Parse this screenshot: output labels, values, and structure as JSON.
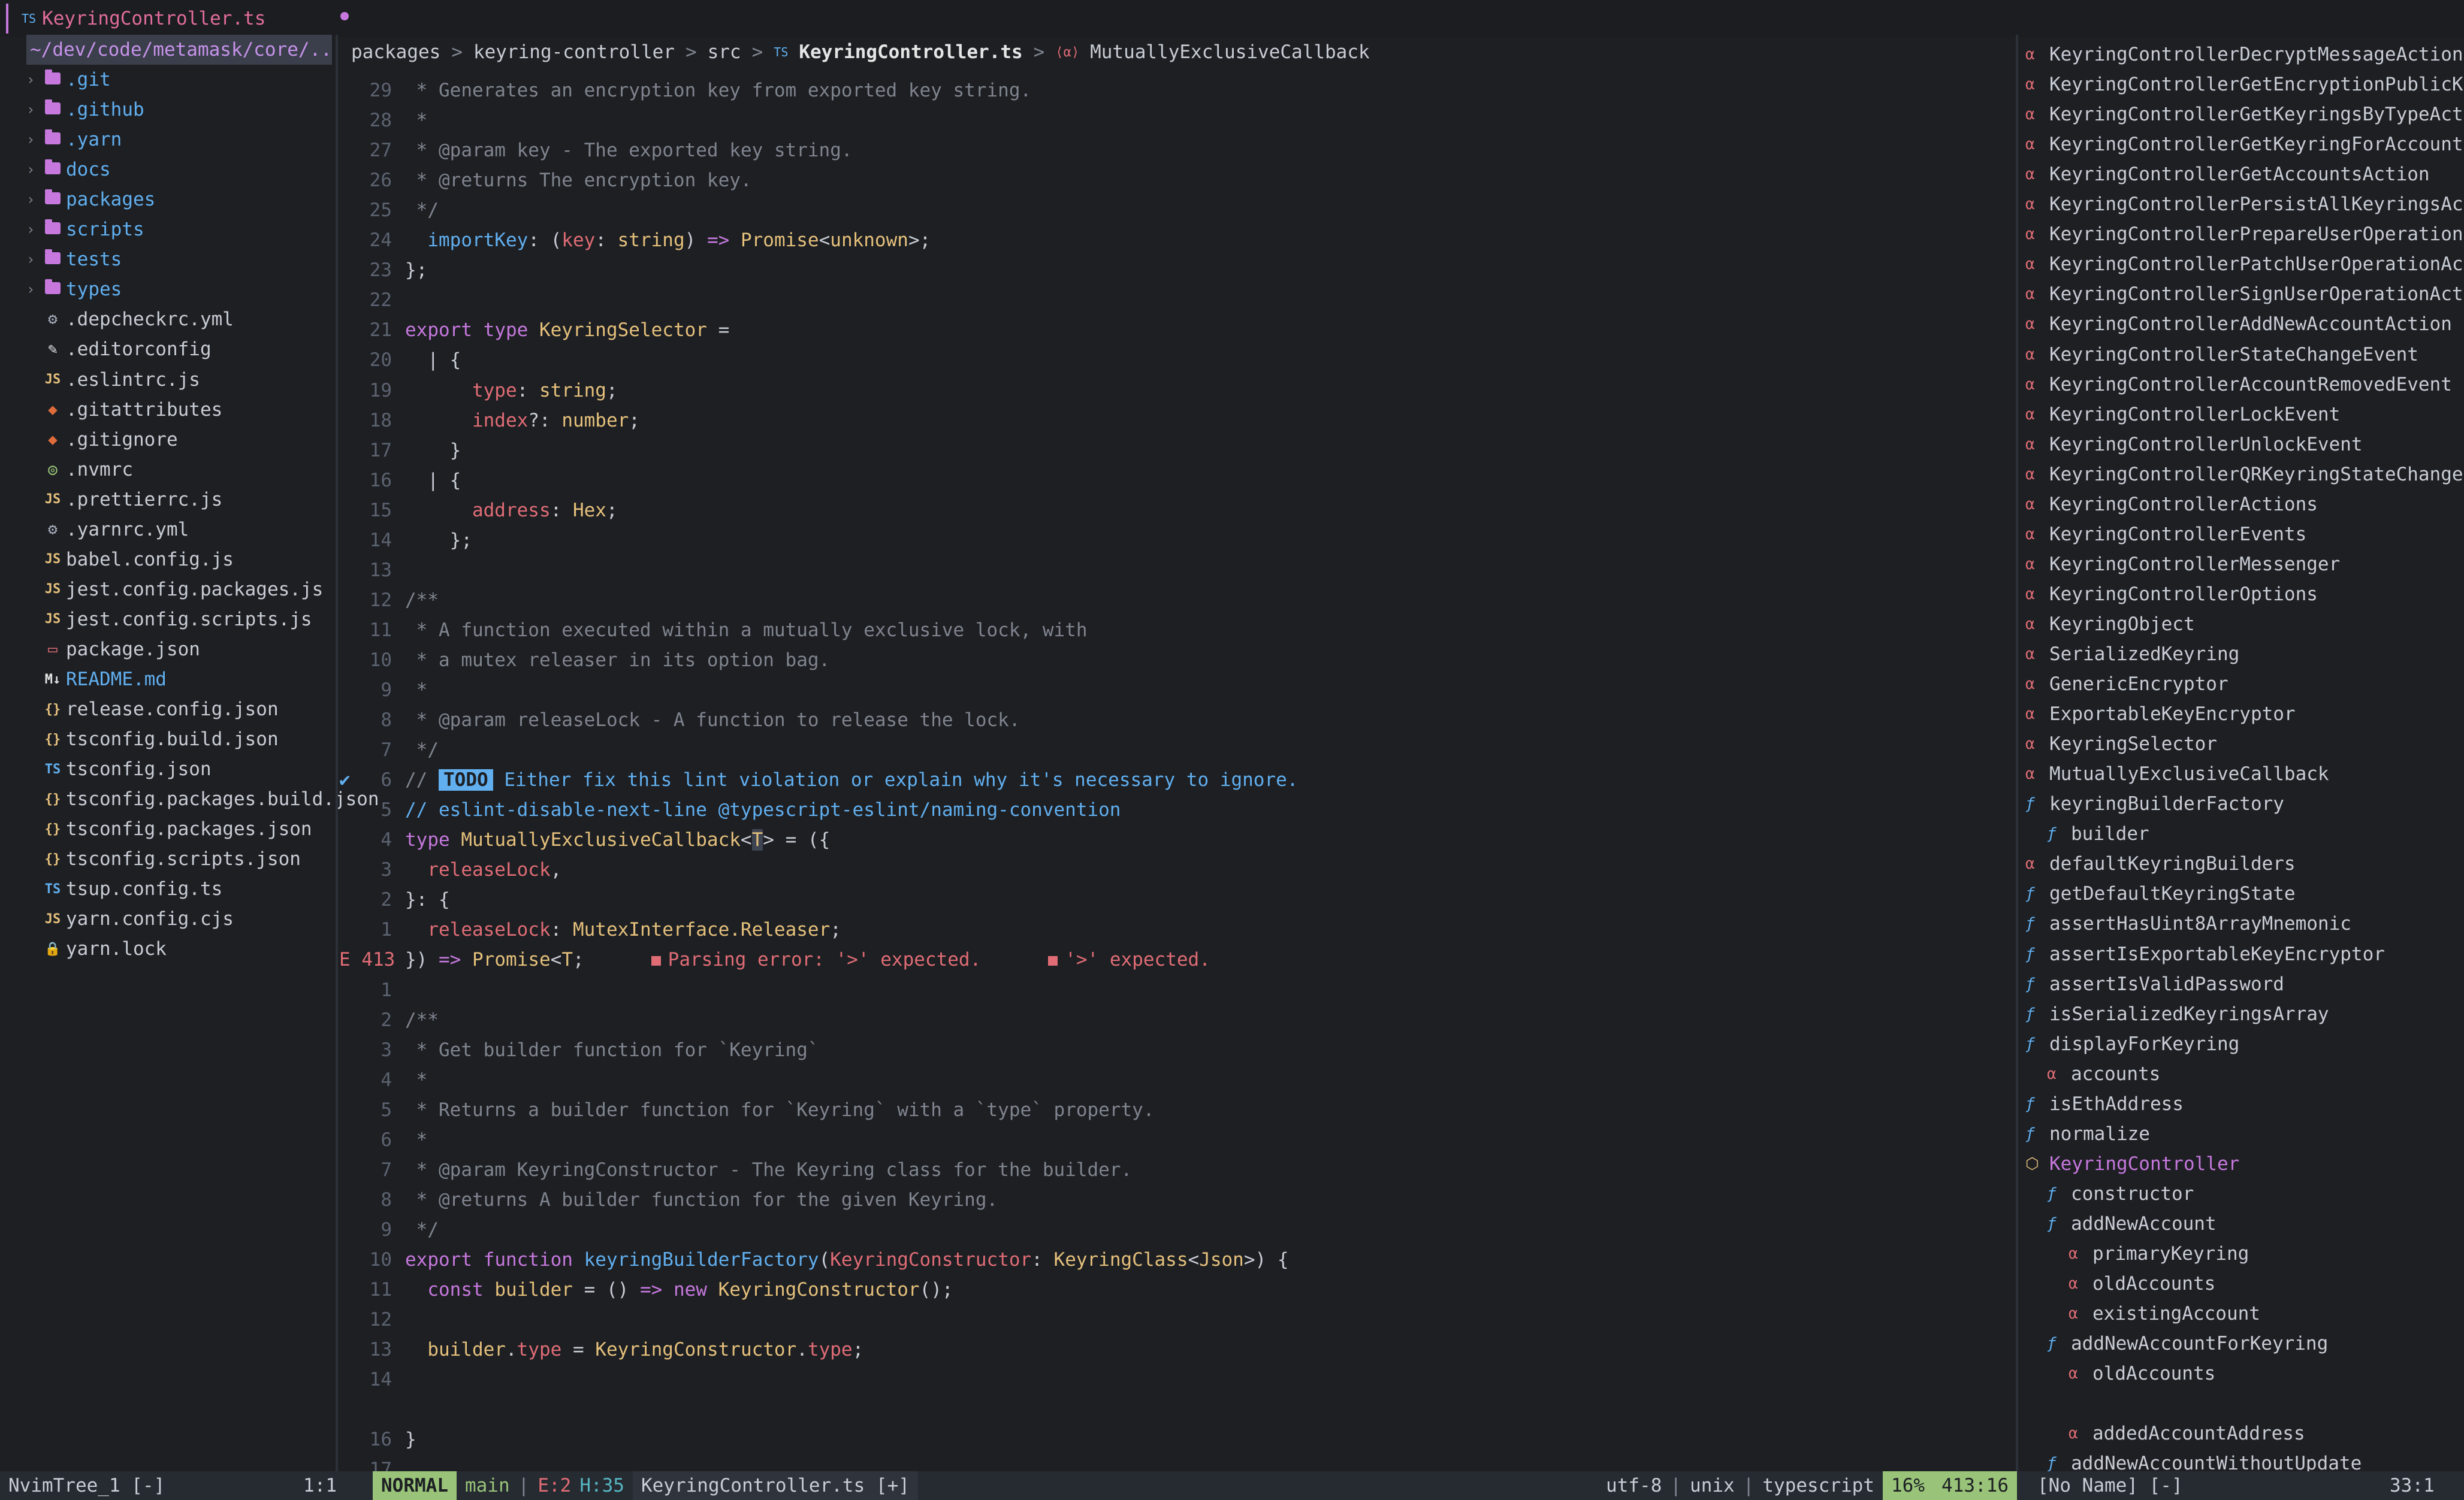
{
  "tabline": {
    "file_type": "TS",
    "file_name": "KeyringController.ts"
  },
  "tree": {
    "root": "~/dev/code/metamask/core/..",
    "dirs": [
      ".git",
      ".github",
      ".yarn",
      "docs",
      "packages",
      "scripts",
      "tests",
      "types"
    ],
    "files": [
      {
        "icon": "gear-icon",
        "glyph": "⚙",
        "color": "#abb2bf",
        "name": ".depcheckrc.yml"
      },
      {
        "icon": "editorconfig-icon",
        "glyph": "✎",
        "color": "#e5e5e5",
        "name": ".editorconfig"
      },
      {
        "icon": "js-icon",
        "glyph": "JS",
        "color": "#e5c07b",
        "name": ".eslintrc.js"
      },
      {
        "icon": "git-icon",
        "glyph": "◆",
        "color": "#e06c3b",
        "name": ".gitattributes"
      },
      {
        "icon": "git-icon",
        "glyph": "◆",
        "color": "#e06c3b",
        "name": ".gitignore"
      },
      {
        "icon": "node-icon",
        "glyph": "◎",
        "color": "#98c379",
        "name": ".nvmrc"
      },
      {
        "icon": "js-icon",
        "glyph": "JS",
        "color": "#e5c07b",
        "name": ".prettierrc.js"
      },
      {
        "icon": "gear-icon",
        "glyph": "⚙",
        "color": "#abb2bf",
        "name": ".yarnrc.yml"
      },
      {
        "icon": "js-icon",
        "glyph": "JS",
        "color": "#e5c07b",
        "name": "babel.config.js"
      },
      {
        "icon": "js-icon",
        "glyph": "JS",
        "color": "#e5c07b",
        "name": "jest.config.packages.js"
      },
      {
        "icon": "js-icon",
        "glyph": "JS",
        "color": "#e5c07b",
        "name": "jest.config.scripts.js"
      },
      {
        "icon": "npm-icon",
        "glyph": "▭",
        "color": "#e06c75",
        "name": "package.json"
      },
      {
        "icon": "markdown-icon",
        "glyph": "M↓",
        "color": "#e5e5e5",
        "name": "README.md",
        "highlight": "#61afef"
      },
      {
        "icon": "json-icon",
        "glyph": "{}",
        "color": "#e5c07b",
        "name": "release.config.json"
      },
      {
        "icon": "json-icon",
        "glyph": "{}",
        "color": "#e5c07b",
        "name": "tsconfig.build.json"
      },
      {
        "icon": "ts-icon",
        "glyph": "TS",
        "color": "#61afef",
        "name": "tsconfig.json"
      },
      {
        "icon": "json-icon",
        "glyph": "{}",
        "color": "#e5c07b",
        "name": "tsconfig.packages.build.json"
      },
      {
        "icon": "json-icon",
        "glyph": "{}",
        "color": "#e5c07b",
        "name": "tsconfig.packages.json"
      },
      {
        "icon": "json-icon",
        "glyph": "{}",
        "color": "#e5c07b",
        "name": "tsconfig.scripts.json"
      },
      {
        "icon": "ts-icon",
        "glyph": "TS",
        "color": "#61afef",
        "name": "tsup.config.ts"
      },
      {
        "icon": "js-icon",
        "glyph": "JS",
        "color": "#e5c07b",
        "name": "yarn.config.cjs"
      },
      {
        "icon": "lock-icon",
        "glyph": "🔒",
        "color": "#abb2bf",
        "name": "yarn.lock"
      }
    ]
  },
  "breadcrumb": {
    "parts": [
      "packages",
      "keyring-controller",
      "src"
    ],
    "file_type": "TS",
    "file": "KeyringController.ts",
    "symbol": "MutuallyExclusiveCallback"
  },
  "code": [
    {
      "ln": "29",
      "html": "<span class='cmt'> * Generates an encryption key from exported key string.</span>"
    },
    {
      "ln": "28",
      "html": "<span class='cmt'> *</span>"
    },
    {
      "ln": "27",
      "html": "<span class='cmt'> * @param key - The exported key string.</span>"
    },
    {
      "ln": "26",
      "html": "<span class='cmt'> * @returns The encryption key.</span>"
    },
    {
      "ln": "25",
      "html": "<span class='cmt'> */</span>"
    },
    {
      "ln": "24",
      "html": "  <span class='fn'>importKey</span>: (<span class='pr'>key</span>: <span class='ty'>string</span>) <span class='kw'>=&gt;</span> <span class='ty'>Promise</span>&lt;<span class='ty'>unknown</span>&gt;;"
    },
    {
      "ln": "23",
      "html": "};"
    },
    {
      "ln": "22",
      "html": ""
    },
    {
      "ln": "21",
      "html": "<span class='kw'>export</span> <span class='kw'>type</span> <span class='ty'>KeyringSelector</span> ="
    },
    {
      "ln": "20",
      "html": "  | {"
    },
    {
      "ln": "19",
      "html": "      <span class='pr'>type</span>: <span class='ty'>string</span>;"
    },
    {
      "ln": "18",
      "html": "      <span class='pr'>index</span>?: <span class='ty'>number</span>;"
    },
    {
      "ln": "17",
      "html": "    }"
    },
    {
      "ln": "16",
      "html": "  | {"
    },
    {
      "ln": "15",
      "html": "      <span class='pr'>address</span>: <span class='ty'>Hex</span>;"
    },
    {
      "ln": "14",
      "html": "    };"
    },
    {
      "ln": "13",
      "html": ""
    },
    {
      "ln": "12",
      "html": "<span class='cmt'>/**</span>"
    },
    {
      "ln": "11",
      "html": "<span class='cmt'> * A function executed within a mutually exclusive lock, with</span>"
    },
    {
      "ln": "10",
      "html": "<span class='cmt'> * a mutex releaser in its option bag.</span>"
    },
    {
      "ln": "9",
      "html": "<span class='cmt'> *</span>"
    },
    {
      "ln": "8",
      "html": "<span class='cmt'> * @param releaseLock - A function to release the lock.</span>"
    },
    {
      "ln": "7",
      "html": "<span class='cmt'> */</span>"
    },
    {
      "ln": "6",
      "check": true,
      "html": "<span class='cmt'>// </span><span class='todo'>TODO</span><span class='fn'> Either fix this lint violation or explain why it's necessary to ignore.</span>"
    },
    {
      "ln": "5",
      "html": "<span class='fn'>// eslint-disable-next-line @typescript-eslint/naming-convention</span>"
    },
    {
      "ln": "4",
      "html": "<span class='kw'>type</span> <span class='ty'>MutuallyExclusiveCallback</span>&lt;<span class='ty' style='background:#3e4451'>T</span>&gt; = ({"
    },
    {
      "ln": "3",
      "html": "  <span class='pr'>releaseLock</span>,"
    },
    {
      "ln": "2",
      "html": "}: {"
    },
    {
      "ln": "1",
      "html": "  <span class='pr'>releaseLock</span>: <span class='ty'>MutexInterface.Releaser</span>;"
    },
    {
      "ln": "E 413",
      "err": true,
      "html": "}) <span class='kw'>=&gt;</span> <span class='ty'>Promise</span>&lt;<span class='ty'>T</span>;      <span class='diag-sq'></span><span class='diag'>Parsing error: '&gt;' expected.</span>      <span class='diag-sq'></span><span class='diag'>'&gt;' expected.</span>"
    },
    {
      "ln": "1",
      "html": ""
    },
    {
      "ln": "2",
      "html": "<span class='cmt'>/**</span>"
    },
    {
      "ln": "3",
      "html": "<span class='cmt'> * Get builder function for `Keyring`</span>"
    },
    {
      "ln": "4",
      "html": "<span class='cmt'> *</span>"
    },
    {
      "ln": "5",
      "html": "<span class='cmt'> * Returns a builder function for `Keyring` with a `type` property.</span>"
    },
    {
      "ln": "6",
      "html": "<span class='cmt'> *</span>"
    },
    {
      "ln": "7",
      "html": "<span class='cmt'> * @param KeyringConstructor - The Keyring class for the builder.</span>"
    },
    {
      "ln": "8",
      "html": "<span class='cmt'> * @returns A builder function for the given Keyring.</span>"
    },
    {
      "ln": "9",
      "html": "<span class='cmt'> */</span>"
    },
    {
      "ln": "10",
      "html": "<span class='kw'>export</span> <span class='kw'>function</span> <span class='fn'>keyringBuilderFactory</span>(<span class='pr'>KeyringConstructor</span>: <span class='ty'>KeyringClass</span>&lt;<span class='ty'>Json</span>&gt;) {"
    },
    {
      "ln": "11",
      "html": "  <span class='kw'>const</span> <span class='ty'>builder</span> = () <span class='kw'>=&gt;</span> <span class='kw'>new</span> <span class='ty'>KeyringConstructor</span>();"
    },
    {
      "ln": "12",
      "html": ""
    },
    {
      "ln": "13",
      "html": "  <span class='ty'>builder</span>.<span class='pr'>type</span> = <span class='ty'>KeyringConstructor</span>.<span class='pr'>type</span>;"
    },
    {
      "ln": "14",
      "html": ""
    },
    {
      "ln": "",
      "html": ""
    },
    {
      "ln": "16",
      "html": "}"
    },
    {
      "ln": "17",
      "html": ""
    }
  ],
  "outline": [
    {
      "k": "a",
      "d": 0,
      "t": "KeyringControllerDecryptMessageAction"
    },
    {
      "k": "a",
      "d": 0,
      "t": "KeyringControllerGetEncryptionPublicK"
    },
    {
      "k": "a",
      "d": 0,
      "t": "KeyringControllerGetKeyringsByTypeAct"
    },
    {
      "k": "a",
      "d": 0,
      "t": "KeyringControllerGetKeyringForAccount"
    },
    {
      "k": "a",
      "d": 0,
      "t": "KeyringControllerGetAccountsAction"
    },
    {
      "k": "a",
      "d": 0,
      "t": "KeyringControllerPersistAllKeyringsAc"
    },
    {
      "k": "a",
      "d": 0,
      "t": "KeyringControllerPrepareUserOperation"
    },
    {
      "k": "a",
      "d": 0,
      "t": "KeyringControllerPatchUserOperationAc"
    },
    {
      "k": "a",
      "d": 0,
      "t": "KeyringControllerSignUserOperationAct"
    },
    {
      "k": "a",
      "d": 0,
      "t": "KeyringControllerAddNewAccountAction"
    },
    {
      "k": "a",
      "d": 0,
      "t": "KeyringControllerStateChangeEvent"
    },
    {
      "k": "a",
      "d": 0,
      "t": "KeyringControllerAccountRemovedEvent"
    },
    {
      "k": "a",
      "d": 0,
      "t": "KeyringControllerLockEvent"
    },
    {
      "k": "a",
      "d": 0,
      "t": "KeyringControllerUnlockEvent"
    },
    {
      "k": "a",
      "d": 0,
      "t": "KeyringControllerQRKeyringStateChange"
    },
    {
      "k": "a",
      "d": 0,
      "t": "KeyringControllerActions"
    },
    {
      "k": "a",
      "d": 0,
      "t": "KeyringControllerEvents"
    },
    {
      "k": "a",
      "d": 0,
      "t": "KeyringControllerMessenger"
    },
    {
      "k": "a",
      "d": 0,
      "t": "KeyringControllerOptions"
    },
    {
      "k": "a",
      "d": 0,
      "t": "KeyringObject"
    },
    {
      "k": "a",
      "d": 0,
      "t": "SerializedKeyring"
    },
    {
      "k": "a",
      "d": 0,
      "t": "GenericEncryptor"
    },
    {
      "k": "a",
      "d": 0,
      "t": "ExportableKeyEncryptor"
    },
    {
      "k": "a",
      "d": 0,
      "t": "KeyringSelector"
    },
    {
      "k": "a",
      "d": 0,
      "t": "MutuallyExclusiveCallback"
    },
    {
      "k": "f",
      "d": 0,
      "t": "keyringBuilderFactory"
    },
    {
      "k": "f",
      "d": 1,
      "t": "builder"
    },
    {
      "k": "a",
      "d": 0,
      "t": "defaultKeyringBuilders"
    },
    {
      "k": "f",
      "d": 0,
      "t": "getDefaultKeyringState"
    },
    {
      "k": "f",
      "d": 0,
      "t": "assertHasUint8ArrayMnemonic"
    },
    {
      "k": "f",
      "d": 0,
      "t": "assertIsExportableKeyEncryptor"
    },
    {
      "k": "f",
      "d": 0,
      "t": "assertIsValidPassword"
    },
    {
      "k": "f",
      "d": 0,
      "t": "isSerializedKeyringsArray"
    },
    {
      "k": "f",
      "d": 0,
      "t": "displayForKeyring"
    },
    {
      "k": "a",
      "d": 1,
      "t": "accounts"
    },
    {
      "k": "f",
      "d": 0,
      "t": "isEthAddress"
    },
    {
      "k": "f",
      "d": 0,
      "t": "normalize"
    },
    {
      "k": "c",
      "d": 0,
      "t": "KeyringController",
      "sel": true
    },
    {
      "k": "f",
      "d": 1,
      "t": "constructor"
    },
    {
      "k": "f",
      "d": 1,
      "t": "addNewAccount"
    },
    {
      "k": "a",
      "d": 2,
      "t": "primaryKeyring"
    },
    {
      "k": "a",
      "d": 2,
      "t": "oldAccounts"
    },
    {
      "k": "a",
      "d": 2,
      "t": "existingAccount"
    },
    {
      "k": "f",
      "d": 1,
      "t": "addNewAccountForKeyring"
    },
    {
      "k": "a",
      "d": 2,
      "t": "oldAccounts"
    },
    {
      "k": "",
      "d": 0,
      "t": ""
    },
    {
      "k": "a",
      "d": 2,
      "t": "addedAccountAddress"
    },
    {
      "k": "f",
      "d": 1,
      "t": "addNewAccountWithoutUpdate"
    }
  ],
  "status": {
    "tree_name": "NvimTree_1 [-]",
    "tree_pos": "1:1",
    "mode": "NORMAL",
    "branch": "main",
    "diag_errors": "E:2",
    "diag_hints": "H:35",
    "file": "KeyringController.ts [+]",
    "encoding": "utf-8",
    "format": "unix",
    "filetype": "typescript",
    "percent": "16%",
    "position": "413:16",
    "outline_name": "[No Name] [-]",
    "outline_pos": "33:1"
  },
  "colors": {
    "accent": "#c678dd",
    "mode_bg": "#98c379",
    "error": "#e06c75",
    "blue": "#61afef"
  }
}
